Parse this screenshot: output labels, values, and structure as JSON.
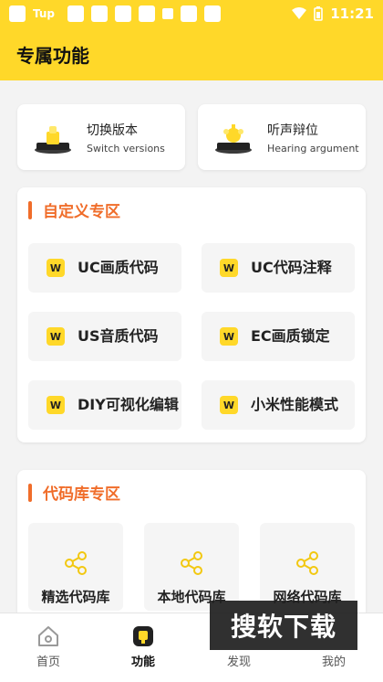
{
  "status_bar": {
    "carrier": "Tup",
    "time": "11:21"
  },
  "header": {
    "title": "专属功能"
  },
  "top_cards": [
    {
      "title": "切换版本",
      "subtitle": "Switch versions"
    },
    {
      "title": "听声辩位",
      "subtitle": "Hearing argument"
    }
  ],
  "custom_zone": {
    "title": "自定义专区",
    "items": [
      {
        "label": "UC画质代码"
      },
      {
        "label": "UC代码注释"
      },
      {
        "label": "US音质代码"
      },
      {
        "label": "EC画质锁定"
      },
      {
        "label": "DIY可视化编辑"
      },
      {
        "label": "小米性能模式"
      }
    ]
  },
  "code_zone": {
    "title": "代码库专区",
    "items": [
      {
        "label": "精选代码库"
      },
      {
        "label": "本地代码库"
      },
      {
        "label": "网络代码库"
      }
    ]
  },
  "tabs": [
    {
      "label": "首页"
    },
    {
      "label": "功能"
    },
    {
      "label": "发现"
    },
    {
      "label": "我的"
    }
  ],
  "watermark": "搜软下载",
  "colors": {
    "accent": "#ffd829",
    "section_title": "#f06d2a"
  }
}
